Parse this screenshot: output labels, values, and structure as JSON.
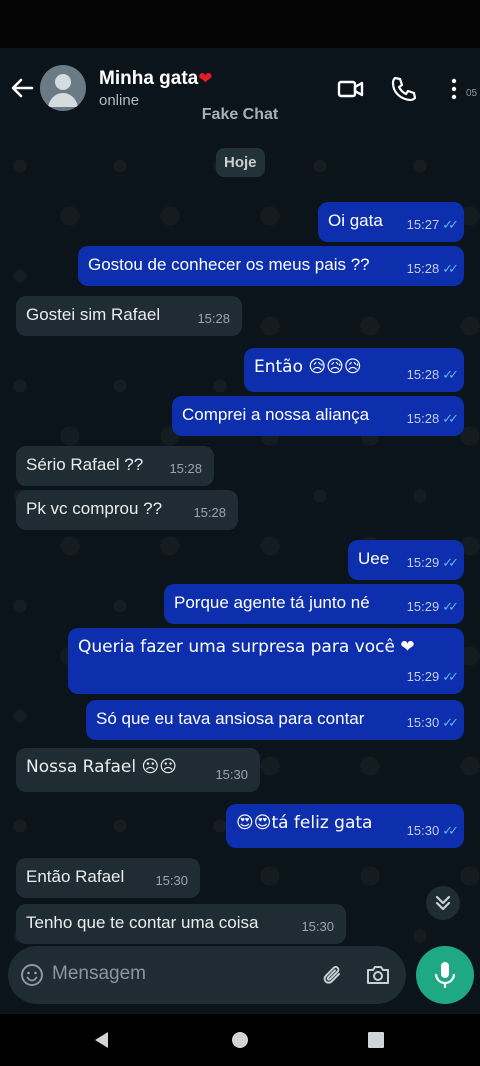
{
  "header": {
    "contact_name": "Minha gata",
    "heart": "❤",
    "status": "online",
    "watermark": "Fake Chat",
    "edge_text": "05"
  },
  "chat": {
    "date_chip": "Hoje",
    "messages": [
      {
        "dir": "out",
        "text": "Oi gata",
        "time": "15:27"
      },
      {
        "dir": "out",
        "text": "Gostou de conhecer os meus pais ??",
        "time": "15:28"
      },
      {
        "dir": "in",
        "text": "Gostei sim Rafael",
        "time": "15:28"
      },
      {
        "dir": "out",
        "text": "Então 😥😥😥",
        "time": "15:28"
      },
      {
        "dir": "out",
        "text": "Comprei a nossa aliança",
        "time": "15:28"
      },
      {
        "dir": "in",
        "text": "Sério Rafael ??",
        "time": "15:28"
      },
      {
        "dir": "in",
        "text": "Pk vc comprou ??",
        "time": "15:28"
      },
      {
        "dir": "out",
        "text": "Uee",
        "time": "15:29"
      },
      {
        "dir": "out",
        "text": "Porque agente tá junto né",
        "time": "15:29"
      },
      {
        "dir": "out",
        "text": "Queria fazer uma surpresa para você ❤",
        "time": "15:29"
      },
      {
        "dir": "out",
        "text": "Só que eu tava ansiosa para contar",
        "time": "15:30"
      },
      {
        "dir": "in",
        "text": "Nossa Rafael ☹☹",
        "time": "15:30"
      },
      {
        "dir": "out",
        "text": "😍😍tá feliz gata",
        "time": "15:30"
      },
      {
        "dir": "in",
        "text": "Então Rafael",
        "time": "15:30"
      },
      {
        "dir": "in",
        "text": "Tenho que te contar uma coisa",
        "time": "15:30"
      }
    ]
  },
  "composer": {
    "placeholder": "Mensagem"
  },
  "icons": {
    "back": "back-arrow-icon",
    "video": "video-call-icon",
    "phone": "voice-call-icon",
    "menu": "more-vertical-icon",
    "emoji": "emoji-icon",
    "attach": "paperclip-icon",
    "camera": "camera-icon",
    "mic": "microphone-icon",
    "scroll": "double-chevron-down-icon"
  },
  "colors": {
    "outgoing_bubble": "#0d2fae",
    "incoming_bubble": "#202c33",
    "read_ticks": "#5fb3f0",
    "mic_button": "#1fa884",
    "heart": "#e31b23"
  }
}
